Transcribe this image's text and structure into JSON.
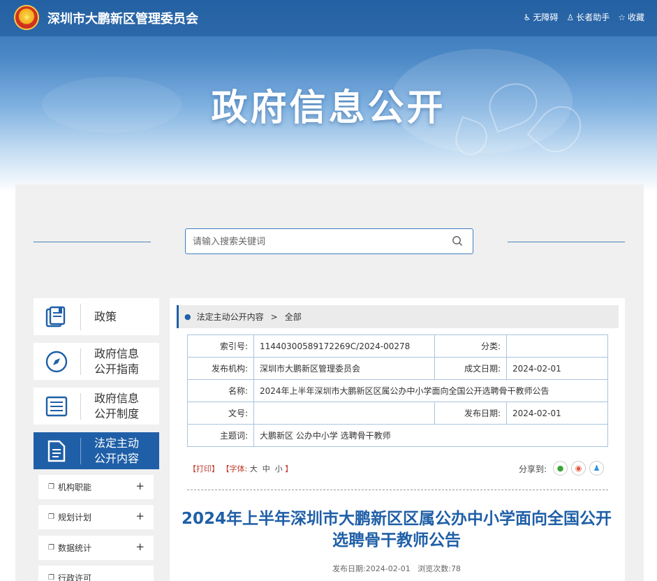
{
  "header": {
    "site_title": "深圳市大鹏新区管理委员会",
    "links": [
      {
        "icon": "accessibility-icon",
        "label": "无障碍"
      },
      {
        "icon": "elder-icon",
        "label": "长者助手"
      },
      {
        "icon": "star-icon",
        "label": "收藏"
      }
    ],
    "banner_title": "政府信息公开"
  },
  "search": {
    "placeholder": "请输入搜索关键词"
  },
  "sidebar": {
    "items": [
      {
        "label_1": "政策",
        "label_2": "",
        "icon": "book-icon"
      },
      {
        "label_1": "政府信息",
        "label_2": "公开指南",
        "icon": "compass-icon"
      },
      {
        "label_1": "政府信息",
        "label_2": "公开制度",
        "icon": "list-document-icon"
      },
      {
        "label_1": "法定主动",
        "label_2": "公开内容",
        "icon": "document-icon",
        "active": true
      }
    ],
    "sub_items": [
      {
        "label": "机构职能"
      },
      {
        "label": "规划计划"
      },
      {
        "label": "数据统计"
      },
      {
        "label": "行政许可"
      }
    ]
  },
  "breadcrumb": {
    "section": "法定主动公开内容",
    "separator": ">",
    "current": "全部"
  },
  "meta": {
    "index_label": "索引号:",
    "index_value": "11440300589172269C/2024-00278",
    "category_label": "分类:",
    "category_value": "",
    "publisher_label": "发布机构:",
    "publisher_value": "深圳市大鹏新区管理委员会",
    "created_label": "成文日期:",
    "created_value": "2024-02-01",
    "name_label": "名称:",
    "name_value": "2024年上半年深圳市大鹏新区区属公办中小学面向全国公开选聘骨干教师公告",
    "docno_label": "文号:",
    "docno_value": "",
    "published_label": "发布日期:",
    "published_value": "2024-02-01",
    "keywords_label": "主题词:",
    "keywords_value": "大鹏新区 公办中小学 选聘骨干教师"
  },
  "tools": {
    "print": "【打印】",
    "font_prefix": "【字体:",
    "font_large": "大",
    "font_medium": "中",
    "font_small": "小",
    "font_suffix": "】",
    "share_label": "分享到:"
  },
  "article": {
    "title": "2024年上半年深圳市大鹏新区区属公办中小学面向全国公开选聘骨干教师公告",
    "date_label": "发布日期:",
    "date_value": "2024-02-01",
    "views_label": "浏览次数:",
    "views_value": "78"
  },
  "colors": {
    "primary": "#1f5fa7",
    "accent_red": "#c0392b",
    "panel_bg": "#f0f0f0"
  }
}
